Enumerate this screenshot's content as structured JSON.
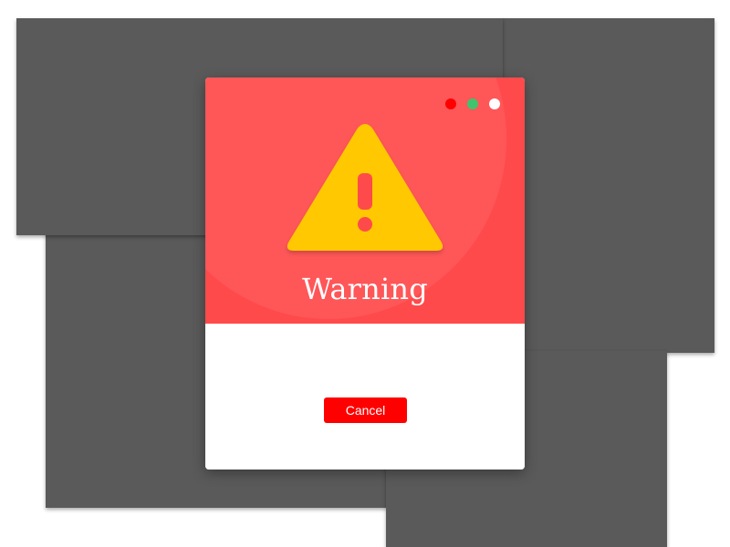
{
  "dialog": {
    "title": "Warning",
    "cancel_label": "Cancel",
    "icon": "warning-triangle-icon",
    "header_color": "#ff4a4c",
    "icon_color": "#ffc800",
    "button_color": "#ff0000"
  },
  "window_controls": [
    {
      "name": "red-dot",
      "color": "#ff0000"
    },
    {
      "name": "green-dot",
      "color": "#3ec46d"
    },
    {
      "name": "white-dot",
      "color": "#ffffff"
    }
  ],
  "background_windows": {
    "color": "#5a5a5a"
  }
}
